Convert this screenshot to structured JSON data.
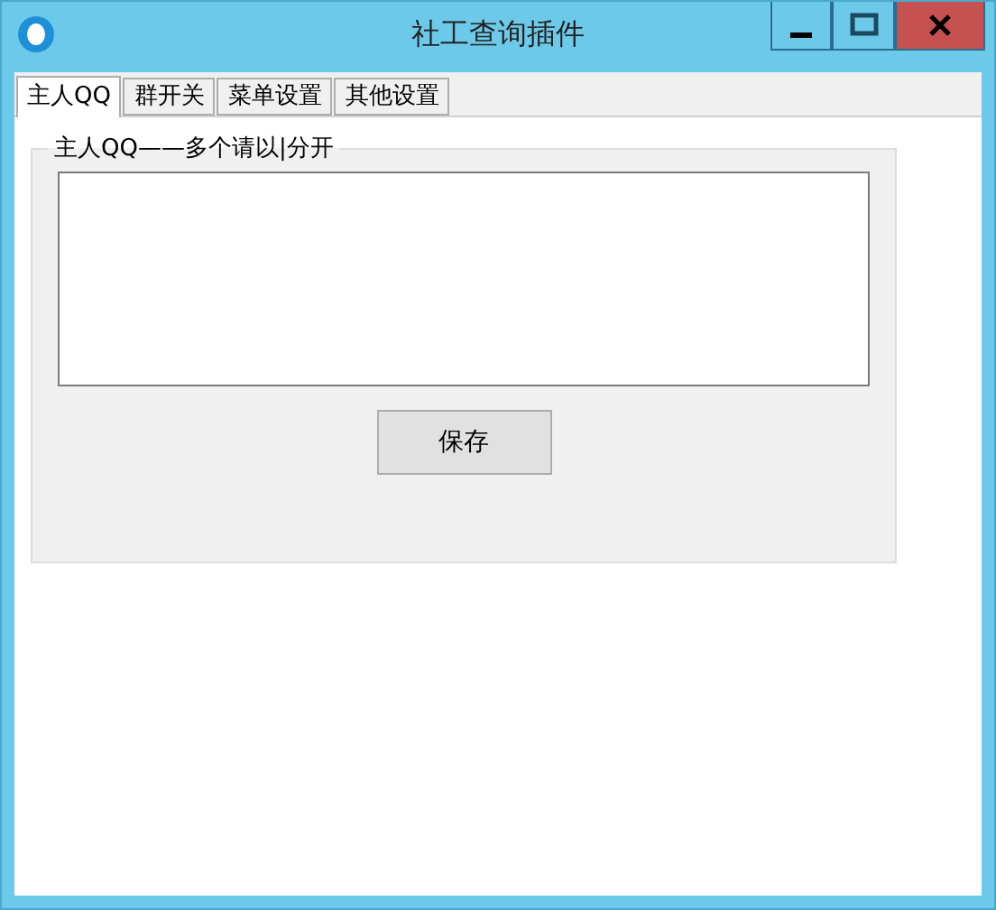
{
  "window": {
    "title": "社工查询插件"
  },
  "tabs": [
    {
      "label": "主人QQ",
      "selected": true
    },
    {
      "label": "群开关",
      "selected": false
    },
    {
      "label": "菜单设置",
      "selected": false
    },
    {
      "label": "其他设置",
      "selected": false
    }
  ],
  "group": {
    "legend": "主人QQ——多个请以|分开",
    "button": "保存"
  }
}
